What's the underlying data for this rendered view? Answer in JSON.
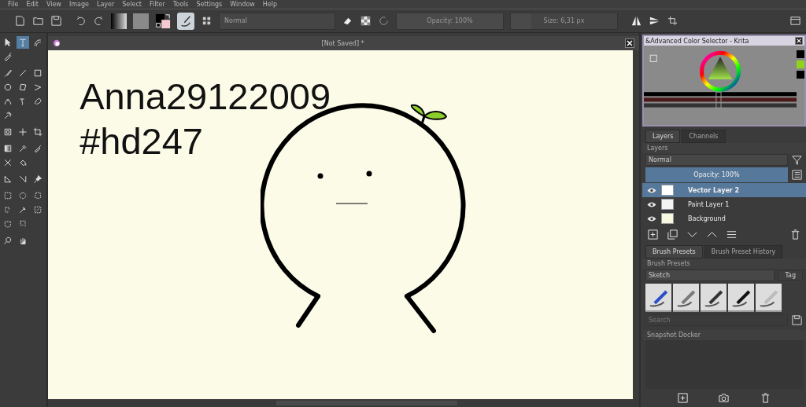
{
  "menu": [
    "File",
    "Edit",
    "View",
    "Image",
    "Layer",
    "Select",
    "Filter",
    "Tools",
    "Settings",
    "Window",
    "Help"
  ],
  "toolbar": {
    "blend_mode": "Normal",
    "opacity": {
      "label": "Opacity: 100%",
      "level": 1
    },
    "size": {
      "label": "Size: 6,31 px",
      "level": 0.19
    }
  },
  "tools": [
    [
      {
        "kind": "pointer",
        "selected": false
      },
      {
        "kind": "text",
        "selected": true
      },
      {
        "kind": "calligraphy",
        "selected": false
      },
      {
        "kind": "pen",
        "selected": false
      }
    ],
    [
      {
        "kind": "brush",
        "selected": false
      },
      {
        "kind": "line",
        "selected": false
      },
      {
        "kind": "rectangle",
        "selected": false
      },
      {
        "kind": "ellipse",
        "selected": false
      },
      {
        "kind": "polygon",
        "selected": false
      },
      {
        "kind": "polyline",
        "selected": false
      },
      {
        "kind": "bezier",
        "selected": false
      },
      {
        "kind": "freehand",
        "selected": false
      },
      {
        "kind": "curve",
        "selected": false
      },
      {
        "kind": "multibrush",
        "selected": false
      }
    ],
    [
      {
        "kind": "transform",
        "selected": false
      },
      {
        "kind": "move",
        "selected": false
      },
      {
        "kind": "crop",
        "selected": false
      }
    ],
    [
      {
        "kind": "gradient",
        "selected": false
      },
      {
        "kind": "picker",
        "selected": false
      },
      {
        "kind": "patch",
        "selected": false
      },
      {
        "kind": "cross",
        "selected": false
      },
      {
        "kind": "fill",
        "selected": false
      }
    ],
    [
      {
        "kind": "measure",
        "selected": false
      },
      {
        "kind": "assistant",
        "selected": false
      },
      {
        "kind": "pin",
        "selected": false
      }
    ],
    [
      {
        "kind": "rect-select",
        "selected": false
      },
      {
        "kind": "ellipse-select",
        "selected": false
      },
      {
        "kind": "poly-select",
        "selected": false
      },
      {
        "kind": "lasso-select",
        "selected": false
      },
      {
        "kind": "wand",
        "selected": false
      },
      {
        "kind": "similar-select",
        "selected": false
      },
      {
        "kind": "bezier-select",
        "selected": false
      },
      {
        "kind": "magnetic-select",
        "selected": false
      }
    ],
    [
      {
        "kind": "zoom",
        "selected": false
      },
      {
        "kind": "pan",
        "selected": false
      }
    ]
  ],
  "document": {
    "title": "[Not Saved]  *",
    "canvas_texts": [
      "Anna29122009",
      "#hd247"
    ]
  },
  "color_selector": {
    "title": "&Advanced Color Selector - Krita"
  },
  "layers_docker": {
    "tabs": [
      {
        "label": "Layers",
        "selected": true
      },
      {
        "label": "Channels",
        "selected": false
      }
    ],
    "title": "Layers",
    "blend_mode": "Normal",
    "opacity": {
      "label": "Opacity:  100%",
      "level": 1
    },
    "layers": [
      {
        "name": "Vector Layer 2",
        "kind": "vector",
        "selected": true,
        "visible": true
      },
      {
        "name": "Paint Layer 1",
        "kind": "paint",
        "selected": false,
        "visible": true
      },
      {
        "name": "Background",
        "kind": "background",
        "selected": false,
        "visible": true
      }
    ]
  },
  "brush_docker": {
    "tabs": [
      {
        "label": "Brush Presets",
        "selected": true
      },
      {
        "label": "Brush Preset History",
        "selected": false
      }
    ],
    "title": "Brush Presets",
    "tag": "Sketch",
    "tag_button": "Tag",
    "search": {
      "placeholder": "Search"
    },
    "presets": [
      {
        "kind": "marker",
        "selected": false
      },
      {
        "kind": "blender",
        "selected": false
      },
      {
        "kind": "pencil",
        "selected": false
      },
      {
        "kind": "ink",
        "selected": false
      },
      {
        "kind": "soft",
        "selected": false
      }
    ]
  },
  "snapshot_docker": {
    "title": "Snapshot Docker"
  }
}
